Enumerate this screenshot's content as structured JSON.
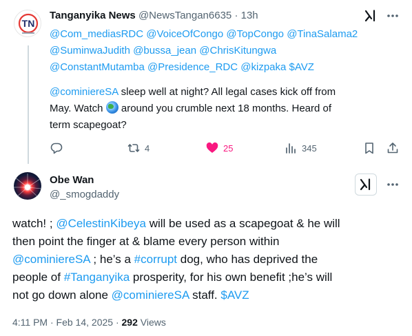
{
  "parent_tweet": {
    "display_name": "Tanganyika News",
    "handle": "@NewsTangan6635",
    "separator": "·",
    "time": "13h",
    "avatar_text": "TN",
    "lines": [
      [
        {
          "t": "@Com_mediasRDC",
          "m": true
        },
        {
          "t": " "
        },
        {
          "t": "@VoiceOfCongo",
          "m": true
        },
        {
          "t": " "
        },
        {
          "t": "@TopCongo",
          "m": true
        },
        {
          "t": " "
        },
        {
          "t": "@TinaSalama2",
          "m": true
        }
      ],
      [
        {
          "t": "@SuminwaJudith",
          "m": true
        },
        {
          "t": " "
        },
        {
          "t": "@bussa_jean",
          "m": true
        },
        {
          "t": " "
        },
        {
          "t": "@ChrisKitungwa",
          "m": true
        }
      ],
      [
        {
          "t": "@ConstantMutamba",
          "m": true
        },
        {
          "t": " "
        },
        {
          "t": "@Presidence_RDC",
          "m": true
        },
        {
          "t": " "
        },
        {
          "t": "@kizpaka",
          "m": true
        },
        {
          "t": " "
        },
        {
          "t": "$AVZ",
          "m": true
        }
      ],
      [],
      [
        {
          "t": "@cominiereSA",
          "m": true
        },
        {
          "t": " sleep well at night? All legal cases kick off from"
        }
      ],
      [
        {
          "t": "May. Watch "
        },
        {
          "t": "globe",
          "emoji": true
        },
        {
          "t": " around you crumble next 18 months. Heard of"
        }
      ],
      [
        {
          "t": "term scapegoat?"
        }
      ]
    ],
    "stats": {
      "replies": "",
      "reposts": "4",
      "likes": "25",
      "views": "345"
    }
  },
  "main_tweet": {
    "display_name": "Obe Wan",
    "handle": "@_smogdaddy",
    "lines": [
      [
        {
          "t": "watch! ; "
        },
        {
          "t": "@CelestinKibeya",
          "m": true
        },
        {
          "t": " will be used as a scapegoat & he will"
        }
      ],
      [
        {
          "t": "then point the finger at & blame every person within"
        }
      ],
      [
        {
          "t": "@cominiereSA",
          "m": true
        },
        {
          "t": " ; he’s a "
        },
        {
          "t": "#corrupt",
          "m": true
        },
        {
          "t": " dog, who has deprived the"
        }
      ],
      [
        {
          "t": "people of "
        },
        {
          "t": "#Tanganyika",
          "m": true
        },
        {
          "t": " prosperity, for his own benefit ;he’s will"
        }
      ],
      [
        {
          "t": "not go down alone "
        },
        {
          "t": "@cominiereSA",
          "m": true
        },
        {
          "t": " staff. "
        },
        {
          "t": "$AVZ",
          "m": true
        }
      ]
    ],
    "timestamp": "4:11 PM · Feb 14, 2025 · ",
    "views_count": "292",
    "views_label": " Views"
  },
  "colors": {
    "link": "#1d9bf0",
    "muted": "#536471",
    "like": "#f91880",
    "avatar_red": "#e53935"
  },
  "icons": [
    "tn-logo",
    "grok-icon",
    "more-icon",
    "reply-icon",
    "repost-icon",
    "like-icon",
    "views-icon",
    "bookmark-icon",
    "share-icon",
    "globe-emoji"
  ]
}
